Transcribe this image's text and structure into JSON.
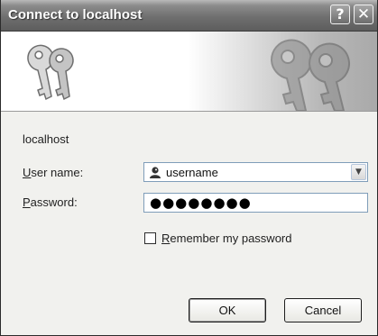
{
  "titlebar": {
    "title": "Connect to localhost",
    "help_glyph": "?",
    "close_glyph": "✕"
  },
  "banner": {
    "icon": "keys-icon"
  },
  "form": {
    "host": "localhost",
    "username_label_accel": "U",
    "username_label_rest": "ser name:",
    "username_value": "username",
    "password_label_accel": "P",
    "password_label_rest": "assword:",
    "password_masked": "●●●●●●●●",
    "remember_accel": "R",
    "remember_rest": "emember my password",
    "remember_checked": false
  },
  "buttons": {
    "ok": "OK",
    "cancel": "Cancel"
  },
  "colors": {
    "titlebar": "#6f6f6f",
    "field_border": "#7f9db9",
    "window_bg": "#f1f1ee"
  }
}
